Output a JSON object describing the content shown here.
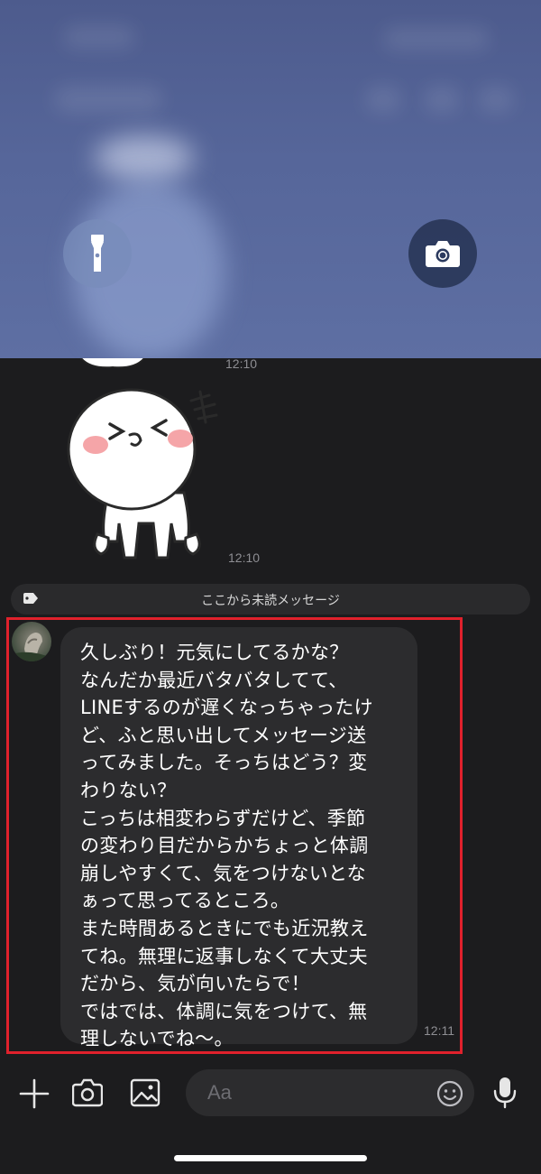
{
  "overlay": {
    "flashlight_icon": "flashlight-icon",
    "camera_icon": "camera-icon"
  },
  "chat": {
    "sticker1_time": "12:10",
    "sticker2_time": "12:10",
    "unread_divider": "ここから未読メッセージ",
    "message": {
      "lines": [
        "久しぶり！元気にしてるかな？",
        "なんだか最近バタバタしてて、",
        "LINEするのが遅くなっちゃったけ",
        "ど、ふと思い出してメッセージ送",
        "ってみました。そっちはどう？変",
        "わりない？",
        "こっちは相変わらずだけど、季節",
        "の変わり目だからかちょっと体調",
        "崩しやすくて、気をつけないとな",
        "ぁって思ってるところ。",
        "また時間あるときにでも近況教え",
        "てね。無理に返事しなくて大丈夫",
        "だから、気が向いたらで！",
        "ではでは、体調に気をつけて、無",
        "理しないでね〜。"
      ],
      "time": "12:11"
    }
  },
  "composer": {
    "placeholder": "Aa"
  },
  "colors": {
    "highlight": "#e0212c",
    "bubble": "#2c2c2e",
    "background": "#1c1c1e"
  }
}
